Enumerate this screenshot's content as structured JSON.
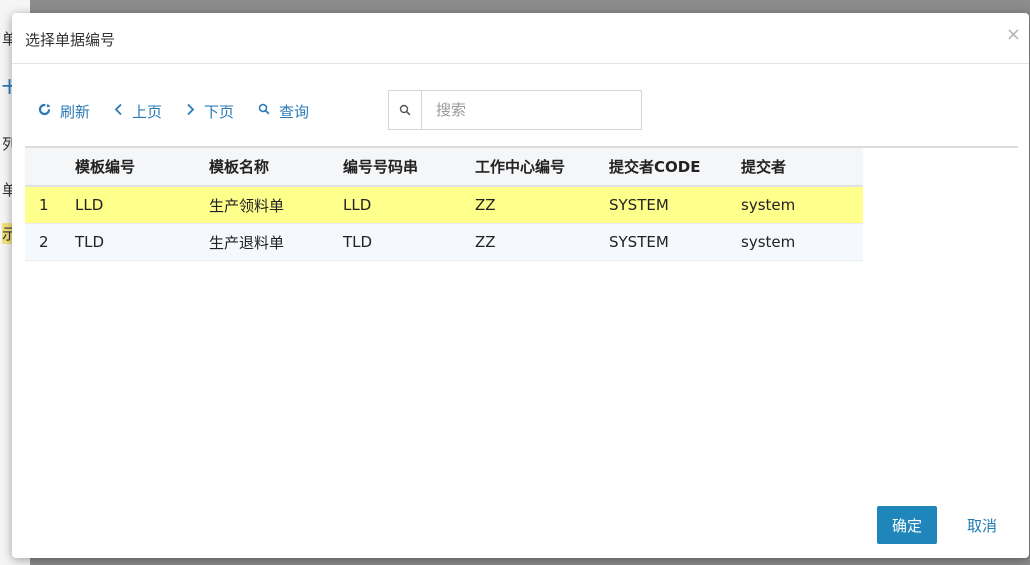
{
  "background": {
    "chars": [
      "单",
      "十",
      "列",
      "单",
      "示"
    ]
  },
  "dialog": {
    "title": "选择单据编号",
    "close_glyph": "×"
  },
  "toolbar": {
    "refresh_label": "刷新",
    "prev_label": "上页",
    "next_label": "下页",
    "query_label": "查询"
  },
  "search": {
    "placeholder": "搜索",
    "value": ""
  },
  "table": {
    "columns": [
      "模板编号",
      "模板名称",
      "编号号码串",
      "工作中心编号",
      "提交者CODE",
      "提交者"
    ],
    "rows": [
      {
        "index": "1",
        "cells": [
          "LLD",
          "生产领料单",
          "LLD",
          "ZZ",
          "SYSTEM",
          "system"
        ]
      },
      {
        "index": "2",
        "cells": [
          "TLD",
          "生产退料单",
          "TLD",
          "ZZ",
          "SYSTEM",
          "system"
        ]
      }
    ]
  },
  "footer": {
    "ok_label": "确定",
    "cancel_label": "取消"
  },
  "colors": {
    "accent": "#2a7ab8",
    "primary_button": "#1e86ba",
    "selected_row": "#ffff8c"
  }
}
